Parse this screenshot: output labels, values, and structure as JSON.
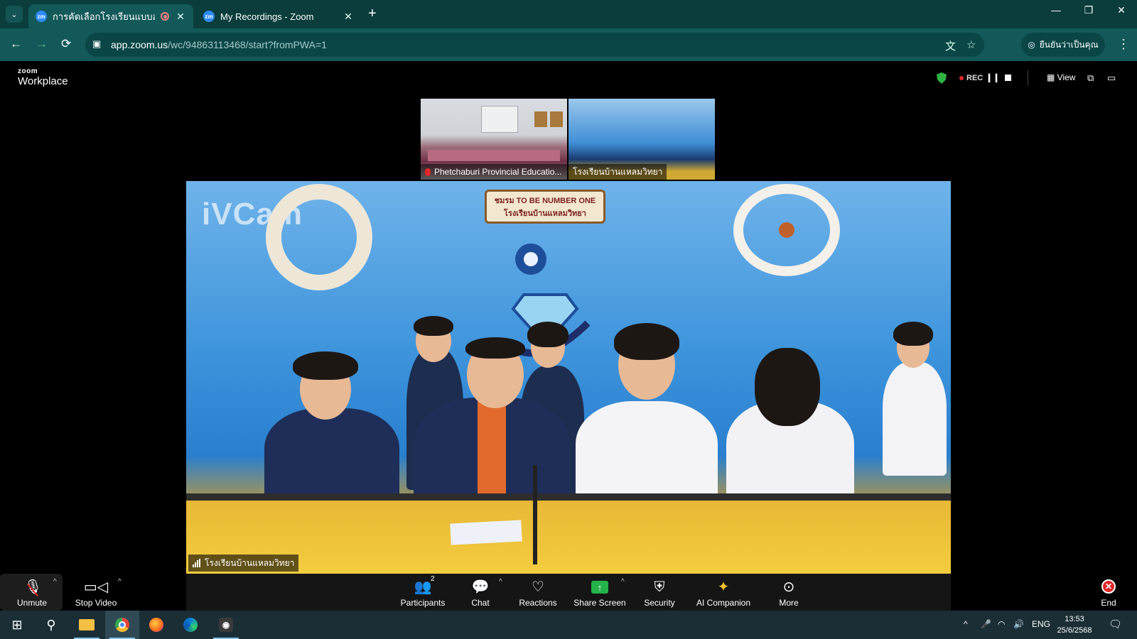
{
  "browser": {
    "tabs": [
      {
        "title": "การคัดเลือกโรงเรียนแบบอย่างก",
        "favicon": "zm",
        "active": true,
        "recording": true
      },
      {
        "title": "My Recordings - Zoom",
        "favicon": "zm",
        "active": false
      }
    ],
    "new_tab": "+",
    "window_controls": {
      "minimize": "—",
      "restore": "❐",
      "close": "✕"
    },
    "nav": {
      "back": "←",
      "forward": "→",
      "reload": "⟳"
    },
    "url": {
      "host": "app.zoom.us",
      "path": "/wc/94863113468/start?fromPWA=1"
    },
    "profile_label": "ยืนยันว่าเป็นคุณ"
  },
  "zoom": {
    "brand_small": "zoom",
    "brand": "Workplace",
    "rec_label": "REC",
    "view_label": "View",
    "thumbnails": [
      {
        "label": "Phetchaburi Provincial Educatio...",
        "muted": true
      },
      {
        "label": "โรงเรียนบ้านแหลมวิทยา",
        "muted": false
      }
    ],
    "main_video": {
      "label": "โรงเรียนบ้านแหลมวิทยา",
      "watermark": "iVCam",
      "banner_line1": "ชมรม TO BE NUMBER ONE",
      "banner_line2": "โรงเรียนบ้านแหลมวิทยา"
    },
    "toolbar": {
      "unmute": "Unmute",
      "stop_video": "Stop Video",
      "participants": "Participants",
      "participants_count": "2",
      "chat": "Chat",
      "reactions": "Reactions",
      "share_screen": "Share Screen",
      "security": "Security",
      "ai_companion": "AI Companion",
      "more": "More",
      "end": "End"
    }
  },
  "taskbar": {
    "lang": "ENG",
    "time": "13:53",
    "date": "25/6/2568"
  },
  "colors": {
    "tab_strip": "#0b3d3d",
    "nav_bar": "#135959",
    "share_green": "#25b24a",
    "end_red": "#e02828",
    "taskbar": "#1b2e36"
  }
}
